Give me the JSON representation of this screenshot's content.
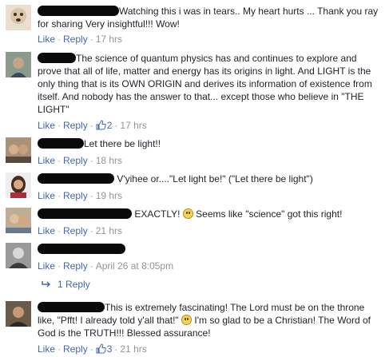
{
  "actions": {
    "like": "Like",
    "reply": "Reply"
  },
  "comments": [
    {
      "text": "Watching this i was in tears.. My heart hurts ... Thank you ray for sharing Very insightful!!! Wow!",
      "time": "17 hrs",
      "likes": ""
    },
    {
      "text": "The science of quantum physics has and continues to explore and prove that all of life, matter and energy has its origins in light. And LIGHT is the only thing that is its OWN ORIGIN and derives its information of existence from itself. And nobody has the answer to that... except those who believe in \"THE LIGHT\"",
      "time": "17 hrs",
      "likes": "2"
    },
    {
      "text": "Let there be light!!",
      "time": "18 hrs",
      "likes": ""
    },
    {
      "text": "V'yihee or....\"Let light be!\" (\"Let there be light\")",
      "time": "19 hrs",
      "likes": ""
    },
    {
      "text_before": "EXACTLY!",
      "text_after": "Seems like \"science\" got this right!",
      "time": "21 hrs",
      "likes": ""
    },
    {
      "text": "",
      "time": "April 26 at 8:05pm",
      "likes": ""
    },
    {
      "text_before": "This is extremely fascinating! The Lord must be on the throne like, \"Pfft! I already told y'all that!\"",
      "text_after": "I'm so glad to be a Christian! The Word of God is the TRUTH!!! Blessed assurance!",
      "time": "21 hrs",
      "likes": "3"
    }
  ],
  "replies_link": "1 Reply",
  "icons": {
    "like_count": "thumbs-up-icon",
    "emoji": "smiley-face-icon",
    "reply": "reply-arrow-icon"
  },
  "colors": {
    "link": "#4267b2",
    "meta": "#90949c",
    "text": "#1d2129"
  }
}
